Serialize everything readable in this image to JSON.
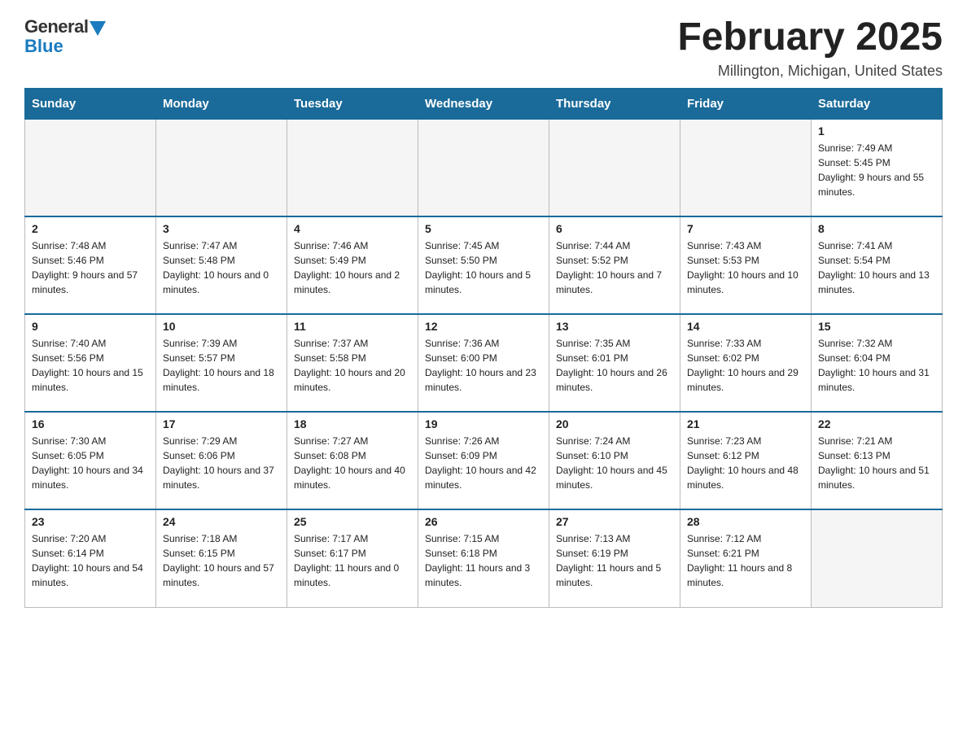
{
  "logo": {
    "general": "General",
    "blue": "Blue"
  },
  "title": "February 2025",
  "subtitle": "Millington, Michigan, United States",
  "days_of_week": [
    "Sunday",
    "Monday",
    "Tuesday",
    "Wednesday",
    "Thursday",
    "Friday",
    "Saturday"
  ],
  "weeks": [
    [
      {
        "day": "",
        "empty": true
      },
      {
        "day": "",
        "empty": true
      },
      {
        "day": "",
        "empty": true
      },
      {
        "day": "",
        "empty": true
      },
      {
        "day": "",
        "empty": true
      },
      {
        "day": "",
        "empty": true
      },
      {
        "day": "1",
        "sunrise": "7:49 AM",
        "sunset": "5:45 PM",
        "daylight": "9 hours and 55 minutes"
      }
    ],
    [
      {
        "day": "2",
        "sunrise": "7:48 AM",
        "sunset": "5:46 PM",
        "daylight": "9 hours and 57 minutes"
      },
      {
        "day": "3",
        "sunrise": "7:47 AM",
        "sunset": "5:48 PM",
        "daylight": "10 hours and 0 minutes"
      },
      {
        "day": "4",
        "sunrise": "7:46 AM",
        "sunset": "5:49 PM",
        "daylight": "10 hours and 2 minutes"
      },
      {
        "day": "5",
        "sunrise": "7:45 AM",
        "sunset": "5:50 PM",
        "daylight": "10 hours and 5 minutes"
      },
      {
        "day": "6",
        "sunrise": "7:44 AM",
        "sunset": "5:52 PM",
        "daylight": "10 hours and 7 minutes"
      },
      {
        "day": "7",
        "sunrise": "7:43 AM",
        "sunset": "5:53 PM",
        "daylight": "10 hours and 10 minutes"
      },
      {
        "day": "8",
        "sunrise": "7:41 AM",
        "sunset": "5:54 PM",
        "daylight": "10 hours and 13 minutes"
      }
    ],
    [
      {
        "day": "9",
        "sunrise": "7:40 AM",
        "sunset": "5:56 PM",
        "daylight": "10 hours and 15 minutes"
      },
      {
        "day": "10",
        "sunrise": "7:39 AM",
        "sunset": "5:57 PM",
        "daylight": "10 hours and 18 minutes"
      },
      {
        "day": "11",
        "sunrise": "7:37 AM",
        "sunset": "5:58 PM",
        "daylight": "10 hours and 20 minutes"
      },
      {
        "day": "12",
        "sunrise": "7:36 AM",
        "sunset": "6:00 PM",
        "daylight": "10 hours and 23 minutes"
      },
      {
        "day": "13",
        "sunrise": "7:35 AM",
        "sunset": "6:01 PM",
        "daylight": "10 hours and 26 minutes"
      },
      {
        "day": "14",
        "sunrise": "7:33 AM",
        "sunset": "6:02 PM",
        "daylight": "10 hours and 29 minutes"
      },
      {
        "day": "15",
        "sunrise": "7:32 AM",
        "sunset": "6:04 PM",
        "daylight": "10 hours and 31 minutes"
      }
    ],
    [
      {
        "day": "16",
        "sunrise": "7:30 AM",
        "sunset": "6:05 PM",
        "daylight": "10 hours and 34 minutes"
      },
      {
        "day": "17",
        "sunrise": "7:29 AM",
        "sunset": "6:06 PM",
        "daylight": "10 hours and 37 minutes"
      },
      {
        "day": "18",
        "sunrise": "7:27 AM",
        "sunset": "6:08 PM",
        "daylight": "10 hours and 40 minutes"
      },
      {
        "day": "19",
        "sunrise": "7:26 AM",
        "sunset": "6:09 PM",
        "daylight": "10 hours and 42 minutes"
      },
      {
        "day": "20",
        "sunrise": "7:24 AM",
        "sunset": "6:10 PM",
        "daylight": "10 hours and 45 minutes"
      },
      {
        "day": "21",
        "sunrise": "7:23 AM",
        "sunset": "6:12 PM",
        "daylight": "10 hours and 48 minutes"
      },
      {
        "day": "22",
        "sunrise": "7:21 AM",
        "sunset": "6:13 PM",
        "daylight": "10 hours and 51 minutes"
      }
    ],
    [
      {
        "day": "23",
        "sunrise": "7:20 AM",
        "sunset": "6:14 PM",
        "daylight": "10 hours and 54 minutes"
      },
      {
        "day": "24",
        "sunrise": "7:18 AM",
        "sunset": "6:15 PM",
        "daylight": "10 hours and 57 minutes"
      },
      {
        "day": "25",
        "sunrise": "7:17 AM",
        "sunset": "6:17 PM",
        "daylight": "11 hours and 0 minutes"
      },
      {
        "day": "26",
        "sunrise": "7:15 AM",
        "sunset": "6:18 PM",
        "daylight": "11 hours and 3 minutes"
      },
      {
        "day": "27",
        "sunrise": "7:13 AM",
        "sunset": "6:19 PM",
        "daylight": "11 hours and 5 minutes"
      },
      {
        "day": "28",
        "sunrise": "7:12 AM",
        "sunset": "6:21 PM",
        "daylight": "11 hours and 8 minutes"
      },
      {
        "day": "",
        "empty": true
      }
    ]
  ]
}
